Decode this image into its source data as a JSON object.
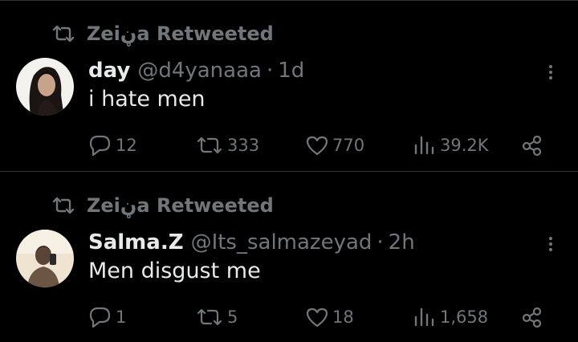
{
  "tweets": [
    {
      "retweeted_by": "Zeiڼa Retweeted",
      "name": "day",
      "handle": "@d4yanaaa",
      "separator": "·",
      "time": "1d",
      "text": "i hate men",
      "replies": "12",
      "reposts": "333",
      "likes": "770",
      "views": "39.2K"
    },
    {
      "retweeted_by": "Zeiڼa Retweeted",
      "name": "Salma.Z",
      "handle": "@Its_salmazeyad",
      "separator": "·",
      "time": "2h",
      "text": "Men disgust me",
      "replies": "1",
      "reposts": "5",
      "likes": "18",
      "views": "1,658"
    }
  ],
  "icons": {
    "retweet": "retweet-icon",
    "reply": "reply-icon",
    "repost": "repost-icon",
    "like": "heart-icon",
    "views": "views-icon",
    "share": "share-icon",
    "more": "more-icon"
  },
  "colors": {
    "background": "#000000",
    "primary_text": "#e7e9ea",
    "secondary_text": "#71767b",
    "divider": "#2f3336"
  }
}
